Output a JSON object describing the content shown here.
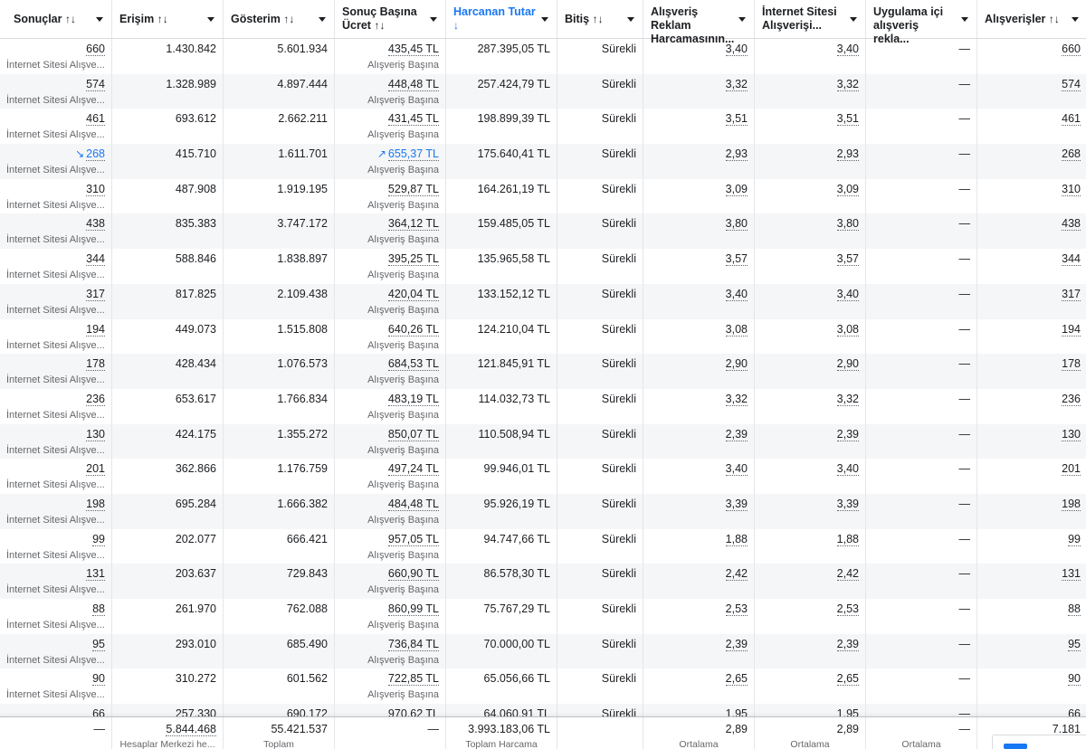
{
  "header": {
    "columns": [
      {
        "label": "Sonuçlar",
        "sort": "↑↓",
        "active": false
      },
      {
        "label": "Erişim",
        "sort": "↑↓",
        "active": false
      },
      {
        "label": "Gösterim",
        "sort": "↑↓",
        "active": false
      },
      {
        "label": "Sonuç Başına Ücret",
        "sort": "↑↓",
        "active": false
      },
      {
        "label": "Harcanan Tutar",
        "sort": "↓",
        "active": true
      },
      {
        "label": "Bitiş",
        "sort": "↑↓",
        "active": false
      },
      {
        "label": "Alışveriş Reklam Harcamasının...",
        "sort": "",
        "active": false
      },
      {
        "label": "İnternet Sitesi Alışverişi...",
        "sort": "",
        "active": false
      },
      {
        "label": "Uygulama içi alışveriş rekla...",
        "sort": "",
        "active": false
      },
      {
        "label": "Alışverişler",
        "sort": "↑↓",
        "active": false
      }
    ]
  },
  "result_sublabel": "İnternet Sitesi Alışve...",
  "cost_sublabel": "Alışveriş Başına",
  "dash": "—",
  "rows": [
    {
      "results": "660",
      "reach": "1.430.842",
      "impr": "5.601.934",
      "cpr": "435,45 TL",
      "spent": "287.395,05 TL",
      "end": "Sürekli",
      "roas": "3,40",
      "web_roas": "3,40",
      "app": "—",
      "purchases": "660"
    },
    {
      "results": "574",
      "reach": "1.328.989",
      "impr": "4.897.444",
      "cpr": "448,48 TL",
      "spent": "257.424,79 TL",
      "end": "Sürekli",
      "roas": "3,32",
      "web_roas": "3,32",
      "app": "—",
      "purchases": "574"
    },
    {
      "results": "461",
      "reach": "693.612",
      "impr": "2.662.211",
      "cpr": "431,45 TL",
      "spent": "198.899,39 TL",
      "end": "Sürekli",
      "roas": "3,51",
      "web_roas": "3,51",
      "app": "—",
      "purchases": "461"
    },
    {
      "results": "268",
      "reach": "415.710",
      "impr": "1.611.701",
      "cpr": "655,37 TL",
      "spent": "175.640,41 TL",
      "end": "Sürekli",
      "roas": "2,93",
      "web_roas": "2,93",
      "app": "—",
      "purchases": "268",
      "trend_down": true,
      "trend_up": true
    },
    {
      "results": "310",
      "reach": "487.908",
      "impr": "1.919.195",
      "cpr": "529,87 TL",
      "spent": "164.261,19 TL",
      "end": "Sürekli",
      "roas": "3,09",
      "web_roas": "3,09",
      "app": "—",
      "purchases": "310"
    },
    {
      "results": "438",
      "reach": "835.383",
      "impr": "3.747.172",
      "cpr": "364,12 TL",
      "spent": "159.485,05 TL",
      "end": "Sürekli",
      "roas": "3,80",
      "web_roas": "3,80",
      "app": "—",
      "purchases": "438"
    },
    {
      "results": "344",
      "reach": "588.846",
      "impr": "1.838.897",
      "cpr": "395,25 TL",
      "spent": "135.965,58 TL",
      "end": "Sürekli",
      "roas": "3,57",
      "web_roas": "3,57",
      "app": "—",
      "purchases": "344"
    },
    {
      "results": "317",
      "reach": "817.825",
      "impr": "2.109.438",
      "cpr": "420,04 TL",
      "spent": "133.152,12 TL",
      "end": "Sürekli",
      "roas": "3,40",
      "web_roas": "3,40",
      "app": "—",
      "purchases": "317"
    },
    {
      "results": "194",
      "reach": "449.073",
      "impr": "1.515.808",
      "cpr": "640,26 TL",
      "spent": "124.210,04 TL",
      "end": "Sürekli",
      "roas": "3,08",
      "web_roas": "3,08",
      "app": "—",
      "purchases": "194"
    },
    {
      "results": "178",
      "reach": "428.434",
      "impr": "1.076.573",
      "cpr": "684,53 TL",
      "spent": "121.845,91 TL",
      "end": "Sürekli",
      "roas": "2,90",
      "web_roas": "2,90",
      "app": "—",
      "purchases": "178"
    },
    {
      "results": "236",
      "reach": "653.617",
      "impr": "1.766.834",
      "cpr": "483,19 TL",
      "spent": "114.032,73 TL",
      "end": "Sürekli",
      "roas": "3,32",
      "web_roas": "3,32",
      "app": "—",
      "purchases": "236"
    },
    {
      "results": "130",
      "reach": "424.175",
      "impr": "1.355.272",
      "cpr": "850,07 TL",
      "spent": "110.508,94 TL",
      "end": "Sürekli",
      "roas": "2,39",
      "web_roas": "2,39",
      "app": "—",
      "purchases": "130"
    },
    {
      "results": "201",
      "reach": "362.866",
      "impr": "1.176.759",
      "cpr": "497,24 TL",
      "spent": "99.946,01 TL",
      "end": "Sürekli",
      "roas": "3,40",
      "web_roas": "3,40",
      "app": "—",
      "purchases": "201"
    },
    {
      "results": "198",
      "reach": "695.284",
      "impr": "1.666.382",
      "cpr": "484,48 TL",
      "spent": "95.926,19 TL",
      "end": "Sürekli",
      "roas": "3,39",
      "web_roas": "3,39",
      "app": "—",
      "purchases": "198"
    },
    {
      "results": "99",
      "reach": "202.077",
      "impr": "666.421",
      "cpr": "957,05 TL",
      "spent": "94.747,66 TL",
      "end": "Sürekli",
      "roas": "1,88",
      "web_roas": "1,88",
      "app": "—",
      "purchases": "99"
    },
    {
      "results": "131",
      "reach": "203.637",
      "impr": "729.843",
      "cpr": "660,90 TL",
      "spent": "86.578,30 TL",
      "end": "Sürekli",
      "roas": "2,42",
      "web_roas": "2,42",
      "app": "—",
      "purchases": "131"
    },
    {
      "results": "88",
      "reach": "261.970",
      "impr": "762.088",
      "cpr": "860,99 TL",
      "spent": "75.767,29 TL",
      "end": "Sürekli",
      "roas": "2,53",
      "web_roas": "2,53",
      "app": "—",
      "purchases": "88"
    },
    {
      "results": "95",
      "reach": "293.010",
      "impr": "685.490",
      "cpr": "736,84 TL",
      "spent": "70.000,00 TL",
      "end": "Sürekli",
      "roas": "2,39",
      "web_roas": "2,39",
      "app": "—",
      "purchases": "95"
    },
    {
      "results": "90",
      "reach": "310.272",
      "impr": "601.562",
      "cpr": "722,85 TL",
      "spent": "65.056,66 TL",
      "end": "Sürekli",
      "roas": "2,65",
      "web_roas": "2,65",
      "app": "—",
      "purchases": "90"
    },
    {
      "results": "66",
      "reach": "257.330",
      "impr": "690.172",
      "cpr": "970,62 TL",
      "spent": "64.060,91 TL",
      "end": "Sürekli",
      "roas": "1,95",
      "web_roas": "1,95",
      "app": "—",
      "purchases": "66"
    }
  ],
  "footer": [
    {
      "value": "—",
      "label": ""
    },
    {
      "value": "5.844.468",
      "label": "Hesaplar Merkezi he..."
    },
    {
      "value": "55.421.537",
      "label": "Toplam"
    },
    {
      "value": "—",
      "label": ""
    },
    {
      "value": "3.993.183,06 TL",
      "label": "Toplam Harcama"
    },
    {
      "value": "",
      "label": ""
    },
    {
      "value": "2,89",
      "label": "Ortalama"
    },
    {
      "value": "2,89",
      "label": "Ortalama"
    },
    {
      "value": "—",
      "label": "Ortalama"
    },
    {
      "value": "7.181",
      "label": ""
    }
  ],
  "colors": {
    "accent": "#1877f2",
    "text": "#1c1e21",
    "muted": "#65676b",
    "row_alt": "#f5f6f7"
  }
}
